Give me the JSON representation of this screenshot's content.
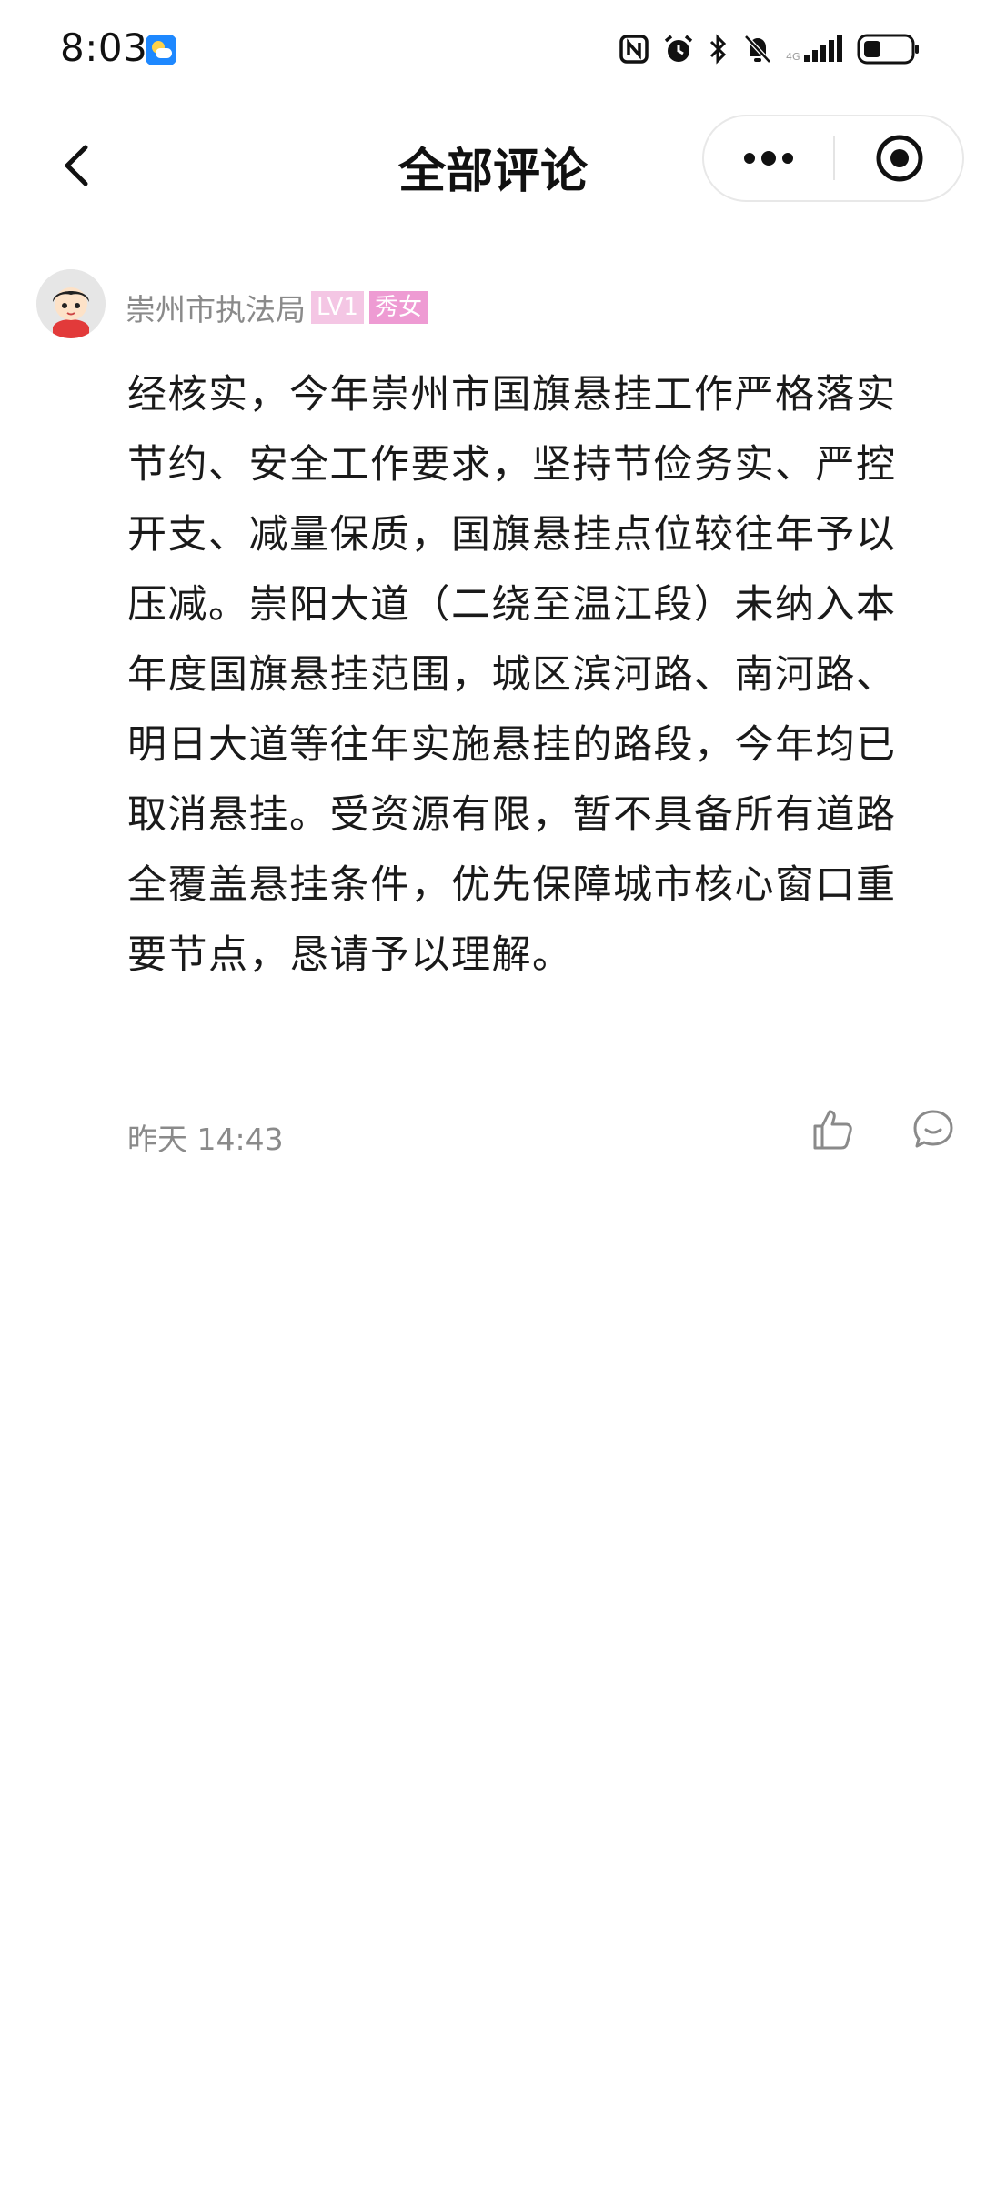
{
  "status_bar": {
    "time": "8:03",
    "icons": [
      "weather-icon",
      "nfc-icon",
      "alarm-icon",
      "bluetooth-icon",
      "mute-icon",
      "signal-icon",
      "battery-icon"
    ]
  },
  "header": {
    "title": "全部评论",
    "back_icon": "chevron-left-icon",
    "more_icon": "more-dots-icon",
    "close_icon": "target-close-icon"
  },
  "comment": {
    "username": "崇州市执法局",
    "level_badge": "LV1",
    "gender_badge": "秀女",
    "text": "经核实，今年崇州市国旗悬挂工作严格落实节约、安全工作要求，坚持节俭务实、严控开支、减量保质，国旗悬挂点位较往年予以压减。崇阳大道（二绕至温江段）未纳入本年度国旗悬挂范围，城区滨河路、南河路、明日大道等往年实施悬挂的路段，今年均已取消悬挂。受资源有限，暂不具备所有道路全覆盖悬挂条件，优先保障城市核心窗口重要节点，恳请予以理解。",
    "time": "昨天 14:43",
    "like_icon": "thumbs-up-icon",
    "reply_icon": "comment-icon"
  },
  "colors": {
    "background": "#ffffff",
    "text_primary": "#1a1a1a",
    "text_secondary": "#8a8a8a",
    "badge_level": "#f4c6e4",
    "badge_gender": "#ee9bd3"
  }
}
